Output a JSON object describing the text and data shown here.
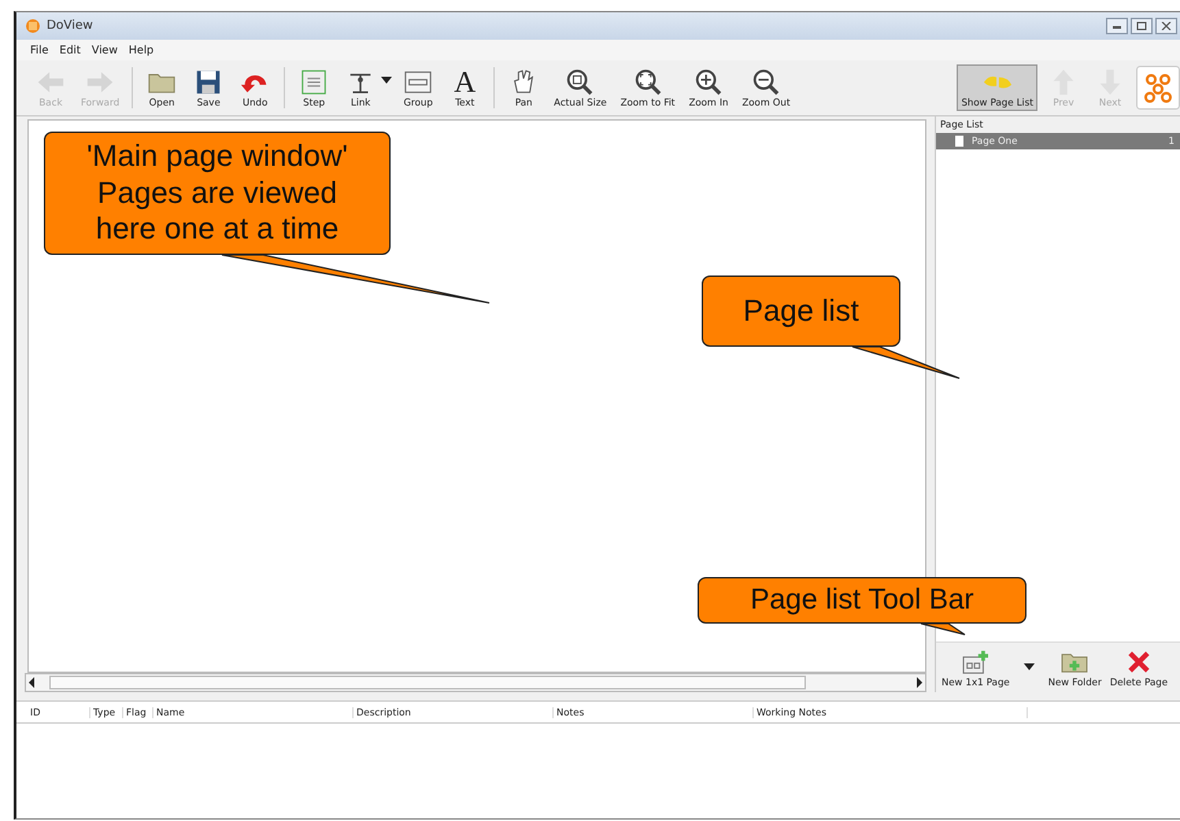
{
  "window": {
    "title": "DoView"
  },
  "menu": [
    "File",
    "Edit",
    "View",
    "Help"
  ],
  "toolbar": [
    [
      {
        "kind": "back",
        "label": "Back",
        "disabled": true
      },
      {
        "kind": "forward",
        "label": "Forward",
        "disabled": true
      }
    ],
    [
      {
        "kind": "open",
        "label": "Open",
        "disabled": false
      },
      {
        "kind": "save",
        "label": "Save",
        "disabled": false
      },
      {
        "kind": "undo",
        "label": "Undo",
        "disabled": false
      }
    ],
    [
      {
        "kind": "step",
        "label": "Step",
        "disabled": false
      },
      {
        "kind": "link",
        "label": "Link",
        "disabled": false
      },
      {
        "kind": "group",
        "label": "Group",
        "disabled": false
      },
      {
        "kind": "text",
        "label": "Text",
        "glyph": "A",
        "disabled": false
      }
    ],
    [
      {
        "kind": "pan",
        "label": "Pan",
        "disabled": false
      },
      {
        "kind": "zoom-actual",
        "label": "Actual Size",
        "disabled": false
      },
      {
        "kind": "zoom-fit",
        "label": "Zoom to Fit",
        "disabled": false
      },
      {
        "kind": "zoom-in",
        "label": "Zoom In",
        "disabled": false
      },
      {
        "kind": "zoom-out",
        "label": "Zoom Out",
        "disabled": false
      }
    ]
  ],
  "right_toolbar": [
    {
      "kind": "show-page-list",
      "label": "Show Page List",
      "disabled": false,
      "selected": true
    },
    {
      "kind": "prev",
      "label": "Prev",
      "disabled": true,
      "selected": false
    },
    {
      "kind": "next",
      "label": "Next",
      "disabled": true,
      "selected": false
    },
    {
      "kind": "logo"
    }
  ],
  "page_list": {
    "title": "Page List",
    "items": [
      {
        "label": "Page One",
        "number": "1",
        "selected": true
      }
    ],
    "toolbar": [
      {
        "kind": "new-page",
        "label": "New 1x1 Page"
      },
      {
        "kind": "dropdown"
      },
      {
        "kind": "new-folder",
        "label": "New Folder"
      },
      {
        "kind": "delete",
        "label": "Delete Page"
      }
    ]
  },
  "table": {
    "columns": [
      "ID",
      "Type",
      "Flag",
      "Name",
      "Description",
      "Notes",
      "Working Notes"
    ]
  },
  "callouts": [
    {
      "lines": [
        "'Main page window'",
        "Pages are viewed",
        "here one at a time"
      ]
    },
    {
      "lines": [
        "Page list"
      ]
    },
    {
      "lines": [
        "Page list Tool Bar"
      ]
    }
  ]
}
